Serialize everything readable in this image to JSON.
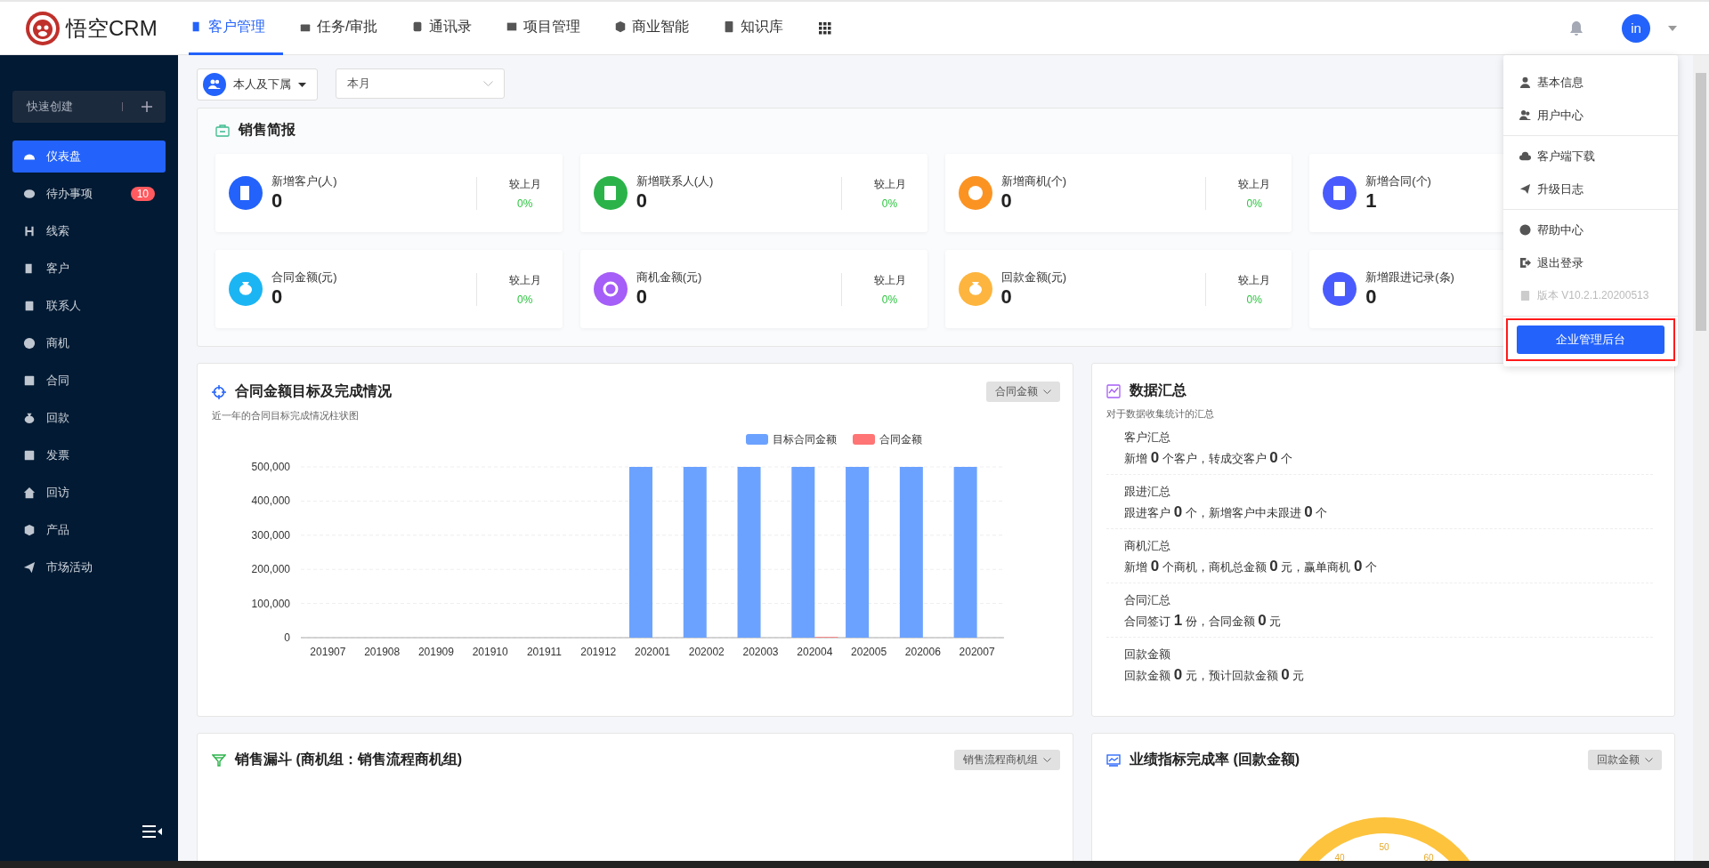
{
  "header": {
    "logo": "悟空CRM",
    "nav": [
      {
        "label": "客户管理",
        "selected": true
      },
      {
        "label": "任务/审批",
        "selected": false
      },
      {
        "label": "通讯录",
        "selected": false
      },
      {
        "label": "项目管理",
        "selected": false
      },
      {
        "label": "商业智能",
        "selected": false
      },
      {
        "label": "知识库",
        "selected": false
      }
    ],
    "avatar": "in"
  },
  "user_menu": {
    "groups": [
      {
        "items": [
          {
            "label": "基本信息",
            "disabled": false
          },
          {
            "label": "用户中心",
            "disabled": false
          }
        ]
      },
      {
        "items": [
          {
            "label": "客户端下载",
            "disabled": false
          },
          {
            "label": "升级日志",
            "disabled": false
          }
        ]
      },
      {
        "items": [
          {
            "label": "帮助中心",
            "disabled": false
          },
          {
            "label": "退出登录",
            "disabled": false
          },
          {
            "label": "版本 V10.2.1.20200513",
            "disabled": true
          }
        ]
      }
    ],
    "button": {
      "label": "企业管理后台",
      "highlighted": true
    }
  },
  "sidebar": {
    "quick_create": "快速创建",
    "items": [
      {
        "label": "仪表盘",
        "selected": true
      },
      {
        "label": "待办事项",
        "selected": false,
        "badge": "10"
      },
      {
        "label": "线索",
        "selected": false
      },
      {
        "label": "客户",
        "selected": false
      },
      {
        "label": "联系人",
        "selected": false
      },
      {
        "label": "商机",
        "selected": false
      },
      {
        "label": "合同",
        "selected": false
      },
      {
        "label": "回款",
        "selected": false
      },
      {
        "label": "发票",
        "selected": false
      },
      {
        "label": "回访",
        "selected": false
      },
      {
        "label": "产品",
        "selected": false
      },
      {
        "label": "市场活动",
        "selected": false
      }
    ]
  },
  "filters": {
    "scope": "本人及下属",
    "period": "本月"
  },
  "sales_brief": {
    "title": "销售简报",
    "stats": [
      {
        "label": "新增客户(人)",
        "value": "0",
        "compare_label": "较上月",
        "compare": "0%",
        "color": "#2362fb"
      },
      {
        "label": "新增联系人(人)",
        "value": "0",
        "compare_label": "较上月",
        "compare": "0%",
        "color": "#2bb34a"
      },
      {
        "label": "新增商机(个)",
        "value": "0",
        "compare_label": "较上月",
        "compare": "0%",
        "color": "#fb9323"
      },
      {
        "label": "新增合同(个)",
        "value": "1",
        "color": "#4a5bfd"
      },
      {
        "label": "合同金额(元)",
        "value": "0",
        "compare_label": "较上月",
        "compare": "0%",
        "color": "#1cb5f3"
      },
      {
        "label": "商机金额(元)",
        "value": "0",
        "compare_label": "较上月",
        "compare": "0%",
        "color": "#a55ef7"
      },
      {
        "label": "回款金额(元)",
        "value": "0",
        "compare_label": "较上月",
        "compare": "0%",
        "color": "#fdb53f"
      },
      {
        "label": "新增跟进记录(条)",
        "value": "0",
        "color": "#4a5bfd"
      }
    ]
  },
  "contract_chart": {
    "title": "合同金额目标及完成情况",
    "subtitle": "近一年的合同目标完成情况柱状图",
    "selector": "合同金额",
    "chart_data": {
      "type": "bar",
      "grid": true,
      "legend": "top-right",
      "categories": [
        "201907",
        "201908",
        "201909",
        "201910",
        "201911",
        "201912",
        "202001",
        "202002",
        "202003",
        "202004",
        "202005",
        "202006",
        "202007"
      ],
      "series": [
        {
          "name": "目标合同金额",
          "color": "#6ca2ff",
          "values": [
            0,
            0,
            0,
            0,
            0,
            0,
            500000,
            500000,
            500000,
            500000,
            500000,
            500000,
            500000
          ]
        },
        {
          "name": "合同金额",
          "color": "#ff7474",
          "values": [
            0,
            0,
            0,
            0,
            0,
            0,
            0,
            0,
            0,
            2000,
            0,
            0,
            0
          ]
        }
      ],
      "ylim": [
        0,
        500000
      ],
      "yticks": [
        {
          "value": 0,
          "label": "0"
        },
        {
          "value": 100000,
          "label": "100,000"
        },
        {
          "value": 200000,
          "label": "200,000"
        },
        {
          "value": 300000,
          "label": "300,000"
        },
        {
          "value": 400000,
          "label": "400,000"
        },
        {
          "value": 500000,
          "label": "500,000"
        }
      ]
    }
  },
  "data_summary": {
    "title": "数据汇总",
    "subtitle": "对于数据收集统计的汇总",
    "items": [
      {
        "title": "客户汇总",
        "text": "新增 **0** 个客户，转成交客户 **0** 个"
      },
      {
        "title": "跟进汇总",
        "text": "跟进客户 **0** 个，新增客户中未跟进 **0** 个"
      },
      {
        "title": "商机汇总",
        "text": "新增 **0** 个商机，商机总金额 **0** 元，赢单商机 **0** 个"
      },
      {
        "title": "合同汇总",
        "text": "合同签订 **1** 份，合同金额 **0** 元"
      },
      {
        "title": "回款金额",
        "text": "回款金额 **0** 元，预计回款金额 **0** 元"
      }
    ]
  },
  "funnel": {
    "title": "销售漏斗 (商机组：销售流程商机组)",
    "selector": "销售流程商机组"
  },
  "performance": {
    "title": "业绩指标完成率 (回款金额)",
    "selector": "回款金额",
    "gauge_labels": [
      "40",
      "50",
      "60"
    ]
  }
}
